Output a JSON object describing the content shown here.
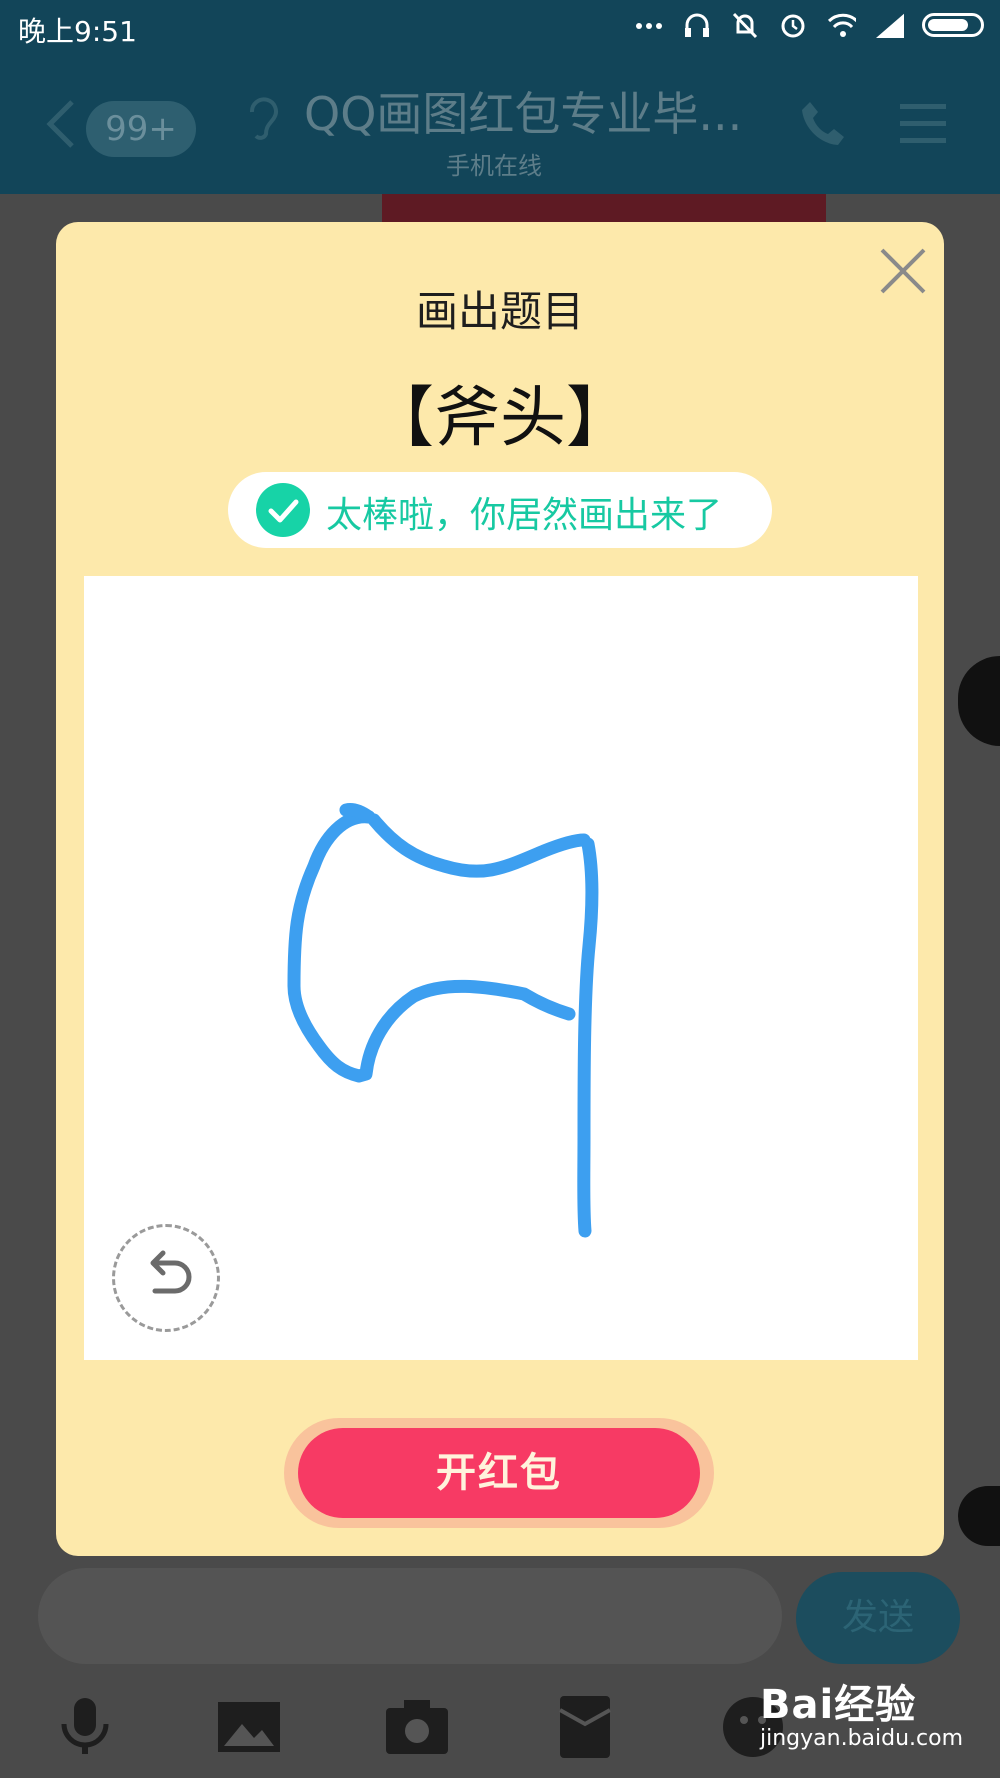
{
  "status_bar": {
    "time": "晚上9:51",
    "icons": [
      "more-icon",
      "headset-icon",
      "mute-icon",
      "alarm-icon",
      "wifi-icon",
      "signal-icon",
      "battery-icon"
    ]
  },
  "chat_header": {
    "back_icon": "chevron-left-icon",
    "unread_badge": "99+",
    "ear_icon": "ear-icon",
    "title": "QQ画图红包专业毕...",
    "subtitle": "手机在线",
    "phone_icon": "phone-icon",
    "menu_icon": "menu-icon"
  },
  "modal": {
    "title": "画出题目",
    "prompt_word": "【斧头】",
    "success_message": "太棒啦，你居然画出来了",
    "close_icon": "close-icon",
    "undo_icon": "undo-icon",
    "open_button": "开红包",
    "colors": {
      "background": "#fde9ab",
      "stroke": "#3d9ff0",
      "success": "#17d3a7",
      "button": "#f73a64"
    }
  },
  "composer": {
    "send_button": "发送",
    "tools": [
      "microphone-icon",
      "image-icon",
      "camera-icon",
      "red-packet-icon",
      "emoji-icon"
    ]
  },
  "watermark": {
    "brand": "Bai经验",
    "url": "jingyan.baidu.com"
  }
}
